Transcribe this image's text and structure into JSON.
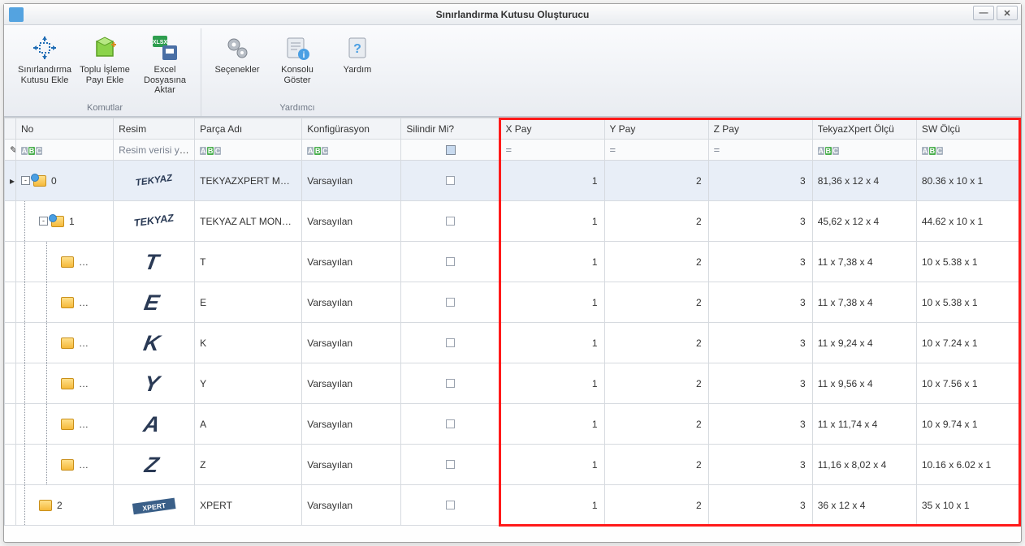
{
  "window": {
    "title": "Sınırlandırma Kutusu Oluşturucu"
  },
  "ribbon": {
    "groups": [
      {
        "caption": "Komutlar",
        "buttons": [
          {
            "key": "add-bb",
            "label": "Sınırlandırma\nKutusu Ekle"
          },
          {
            "key": "batch",
            "label": "Toplu İşleme\nPayı Ekle"
          },
          {
            "key": "excel",
            "label": "Excel Dosyasına\nAktar"
          }
        ]
      },
      {
        "caption": "Yardımcı",
        "buttons": [
          {
            "key": "options",
            "label": "Seçenekler"
          },
          {
            "key": "console",
            "label": "Konsolu\nGöster"
          },
          {
            "key": "help",
            "label": "Yardım"
          }
        ]
      }
    ]
  },
  "grid": {
    "headers": {
      "no": "No",
      "image": "Resim",
      "name": "Parça Adı",
      "conf": "Konfigürasyon",
      "cyl": "Silindir Mi?",
      "x": "X Pay",
      "y": "Y Pay",
      "z": "Z Pay",
      "tx": "TekyazXpert Ölçü",
      "sw": "SW Ölçü"
    },
    "filter_image_text": "Resim verisi yok",
    "rows": [
      {
        "level": 0,
        "asm": true,
        "expand": "-",
        "no": "0",
        "thumb": "tekyaz-banner",
        "name": "TEKYAZXPERT MO…",
        "conf": "Varsayılan",
        "x": "1",
        "y": "2",
        "z": "3",
        "tx": "81,36 x 12 x 4",
        "sw": "80.36 x 10 x 1",
        "selected": true
      },
      {
        "level": 1,
        "asm": true,
        "expand": "-",
        "no": "1",
        "thumb": "tekyaz-word",
        "name": "TEKYAZ ALT MON…",
        "conf": "Varsayılan",
        "x": "1",
        "y": "2",
        "z": "3",
        "tx": "45,62 x 12 x 4",
        "sw": "44.62 x 10 x 1"
      },
      {
        "level": 2,
        "asm": false,
        "no": "…",
        "thumb": "T",
        "name": "T",
        "conf": "Varsayılan",
        "x": "1",
        "y": "2",
        "z": "3",
        "tx": "11 x 7,38 x 4",
        "sw": "10 x 5.38 x 1"
      },
      {
        "level": 2,
        "asm": false,
        "no": "…",
        "thumb": "E",
        "name": "E",
        "conf": "Varsayılan",
        "x": "1",
        "y": "2",
        "z": "3",
        "tx": "11 x 7,38 x 4",
        "sw": "10 x 5.38 x 1"
      },
      {
        "level": 2,
        "asm": false,
        "no": "…",
        "thumb": "K",
        "name": "K",
        "conf": "Varsayılan",
        "x": "1",
        "y": "2",
        "z": "3",
        "tx": "11 x 9,24 x 4",
        "sw": "10 x 7.24 x 1"
      },
      {
        "level": 2,
        "asm": false,
        "no": "…",
        "thumb": "Y",
        "name": "Y",
        "conf": "Varsayılan",
        "x": "1",
        "y": "2",
        "z": "3",
        "tx": "11 x 9,56 x 4",
        "sw": "10 x 7.56 x 1"
      },
      {
        "level": 2,
        "asm": false,
        "no": "…",
        "thumb": "A",
        "name": "A",
        "conf": "Varsayılan",
        "x": "1",
        "y": "2",
        "z": "3",
        "tx": "11 x 11,74 x 4",
        "sw": "10 x 9.74 x 1"
      },
      {
        "level": 2,
        "asm": false,
        "no": "…",
        "thumb": "Z",
        "name": "Z",
        "conf": "Varsayılan",
        "x": "1",
        "y": "2",
        "z": "3",
        "tx": "11,16 x 8,02 x 4",
        "sw": "10.16 x 6.02 x 1"
      },
      {
        "level": 1,
        "asm": false,
        "no": "2",
        "thumb": "xpert-banner",
        "name": "XPERT",
        "conf": "Varsayılan",
        "x": "1",
        "y": "2",
        "z": "3",
        "tx": "36 x 12 x 4",
        "sw": "35 x 10 x 1"
      }
    ]
  }
}
